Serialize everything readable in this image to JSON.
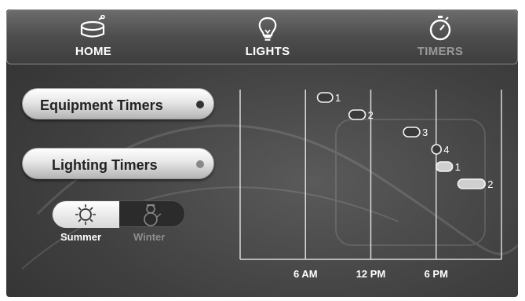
{
  "nav": {
    "home": "HOME",
    "lights": "LIGHTS",
    "timers": "TIMERS"
  },
  "buttons": {
    "equipment": "Equipment Timers",
    "lighting": "Lighting Timers"
  },
  "season": {
    "summer": "Summer",
    "winter": "Winter",
    "selected": "Summer"
  },
  "colors": {
    "active_nav": "#9a9a9a",
    "nav_text": "#ffffff",
    "dot_equipment": "#333333",
    "dot_lighting": "#888888"
  },
  "chart_data": {
    "type": "timeline",
    "xlabel": "",
    "ylabel": "",
    "x_ticks": [
      "6 AM",
      "12 PM",
      "6 PM"
    ],
    "x_tick_hours": [
      6,
      12,
      18
    ],
    "xlim_hours": [
      0,
      24
    ],
    "timers": [
      {
        "label": "1",
        "start": 7.1,
        "end": 8.5,
        "style": "outline"
      },
      {
        "label": "2",
        "start": 10.0,
        "end": 11.5,
        "style": "outline"
      },
      {
        "label": "3",
        "start": 15.0,
        "end": 16.5,
        "style": "outline"
      },
      {
        "label": "4",
        "start": 17.6,
        "end": 18.2,
        "style": "outline"
      },
      {
        "label": "1",
        "start": 18.0,
        "end": 19.5,
        "style": "filled"
      },
      {
        "label": "2",
        "start": 20.0,
        "end": 22.5,
        "style": "filled"
      }
    ]
  }
}
